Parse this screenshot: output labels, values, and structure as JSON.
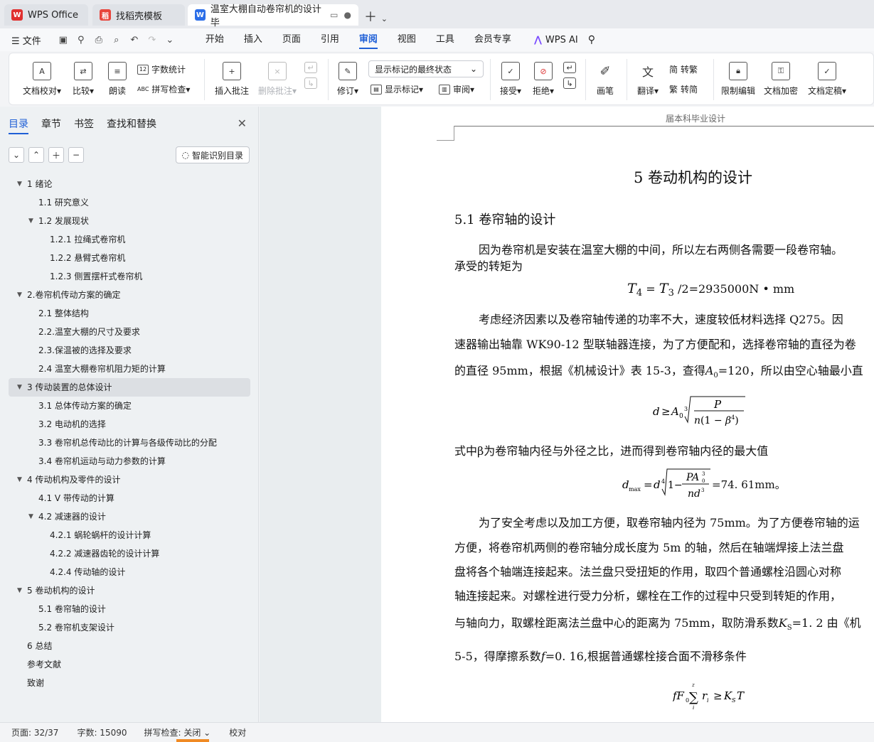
{
  "tabs": [
    {
      "label": "WPS Office",
      "icon": "wps-logo-icon"
    },
    {
      "label": "找稻壳模板",
      "icon": "docer-icon"
    },
    {
      "label": "温室大棚自动卷帘机的设计 毕",
      "icon": "word-doc-icon",
      "active": true
    }
  ],
  "menu": {
    "file": "文件",
    "tabs": [
      "开始",
      "插入",
      "页面",
      "引用",
      "审阅",
      "视图",
      "工具",
      "会员专享"
    ],
    "active_tab": "审阅",
    "ai": "WPS AI"
  },
  "ribbon": {
    "doc_check": "文档校对",
    "compare": "比较",
    "read_aloud": "朗读",
    "word_count": "字数统计",
    "spell_check": "拼写检查",
    "insert_comment": "插入批注",
    "delete_comment": "删除批注",
    "revise": "修订",
    "markup_state": "显示标记的最终状态",
    "show_markup": "显示标记",
    "review": "审阅",
    "accept": "接受",
    "reject": "拒绝",
    "pen": "画笔",
    "translate": "翻译",
    "to_traditional": "转繁",
    "to_simplified": "转简",
    "restrict_edit": "限制编辑",
    "encrypt": "文档加密",
    "finalize": "文档定稿"
  },
  "nav": {
    "tabs": [
      "目录",
      "章节",
      "书签",
      "查找和替换"
    ],
    "active_tab": "目录",
    "smart_btn": "智能识别目录",
    "toc": [
      {
        "label": "1   绪论",
        "level": 1,
        "expanded": true
      },
      {
        "label": "1.1 研究意义",
        "level": 2
      },
      {
        "label": "1.2 发展现状",
        "level": 2,
        "expanded": true
      },
      {
        "label": "1.2.1  拉绳式卷帘机",
        "level": 3
      },
      {
        "label": "1.2.2  悬臂式卷帘机",
        "level": 3
      },
      {
        "label": "1.2.3  侧置摆杆式卷帘机",
        "level": 3
      },
      {
        "label": "2.卷帘机传动方案的确定",
        "level": 1,
        "expanded": true
      },
      {
        "label": "2.1 整体结构",
        "level": 2
      },
      {
        "label": "2.2.温室大棚的尺寸及要求",
        "level": 2
      },
      {
        "label": "2.3.保温被的选择及要求",
        "level": 2
      },
      {
        "label": "2.4 温室大棚卷帘机阻力矩的计算",
        "level": 2
      },
      {
        "label": "3 传动装置的总体设计",
        "level": 1,
        "expanded": true,
        "selected": true
      },
      {
        "label": "3.1 总体传动方案的确定",
        "level": 2
      },
      {
        "label": "3.2 电动机的选择",
        "level": 2
      },
      {
        "label": "3.3  卷帘机总传动比的计算与各级传动比的分配",
        "level": 2
      },
      {
        "label": "3.4  卷帘机运动与动力参数的计算",
        "level": 2
      },
      {
        "label": "4 传动机构及零件的设计",
        "level": 1,
        "expanded": true
      },
      {
        "label": "4.1 V 带传动的计算",
        "level": 2
      },
      {
        "label": "4.2 减速器的设计",
        "level": 2,
        "expanded": true
      },
      {
        "label": "4.2.1  蜗轮蜗杆的设计计算",
        "level": 3
      },
      {
        "label": "4.2.2 减速器齿轮的设计计算",
        "level": 3
      },
      {
        "label": "4.2.4  传动轴的设计",
        "level": 3
      },
      {
        "label": "5 卷动机构的设计",
        "level": 1,
        "expanded": true
      },
      {
        "label": "5.1 卷帘轴的设计",
        "level": 2
      },
      {
        "label": "5.2 卷帘机支架设计",
        "level": 2
      },
      {
        "label": "6 总结",
        "level": 1
      },
      {
        "label": "参考文献",
        "level": 1
      },
      {
        "label": "致谢",
        "level": 1
      }
    ]
  },
  "doc": {
    "header": "届本科毕业设计",
    "title": "5 卷动机构的设计",
    "section": "5.1 卷帘轴的设计",
    "p1a": "因为卷帘机是安装在温室大棚的中间，所以左右两侧各需要一段卷帘轴。",
    "p1b": "承受的转矩为",
    "f1": "/2=2935000N • mm",
    "p2a": "考虑经济因素以及卷帘轴传递的功率不大，速度较低材料选择  Q275。因",
    "p2b": "速器输出轴靠 WK90-12 型联轴器连接，为了方便配和，选择卷帘轴的直径为卷",
    "p2c1": "的直径 95mm，根据《机械设计》表 15-3，查得",
    "p2c2": "=120，所以由空心轴最小直",
    "p3": "式中β为卷帘轴内径与外径之比，进而得到卷帘轴内径的最大值",
    "f3": "=74. 61mm。",
    "p4a": "为了安全考虑以及加工方便，取卷帘轴内径为 75mm。为了方便卷帘轴的运",
    "p4b": "方便，将卷帘机两侧的卷帘轴分成长度为 5m 的轴，然后在轴端焊接上法兰盘",
    "p4c": "盘将各个轴端连接起来。法兰盘只受扭矩的作用，取四个普通螺栓沿圆心对称",
    "p4d": "轴连接起来。对螺栓进行受力分析，螺栓在工作的过程中只受到转矩的作用，",
    "p4e1": "与轴向力，取螺栓距离法兰盘中心的距离为 75mm，取防滑系数",
    "p4e2": "=1. 2 由《机",
    "p4f1": "5-5，得摩擦系数",
    "p4f2": "=0. 16,根据普通螺栓接合面不滑移条件"
  },
  "status": {
    "page": "页面: 32/37",
    "words": "字数: 15090",
    "spell": "拼写检查: 关闭",
    "proof": "校对"
  }
}
